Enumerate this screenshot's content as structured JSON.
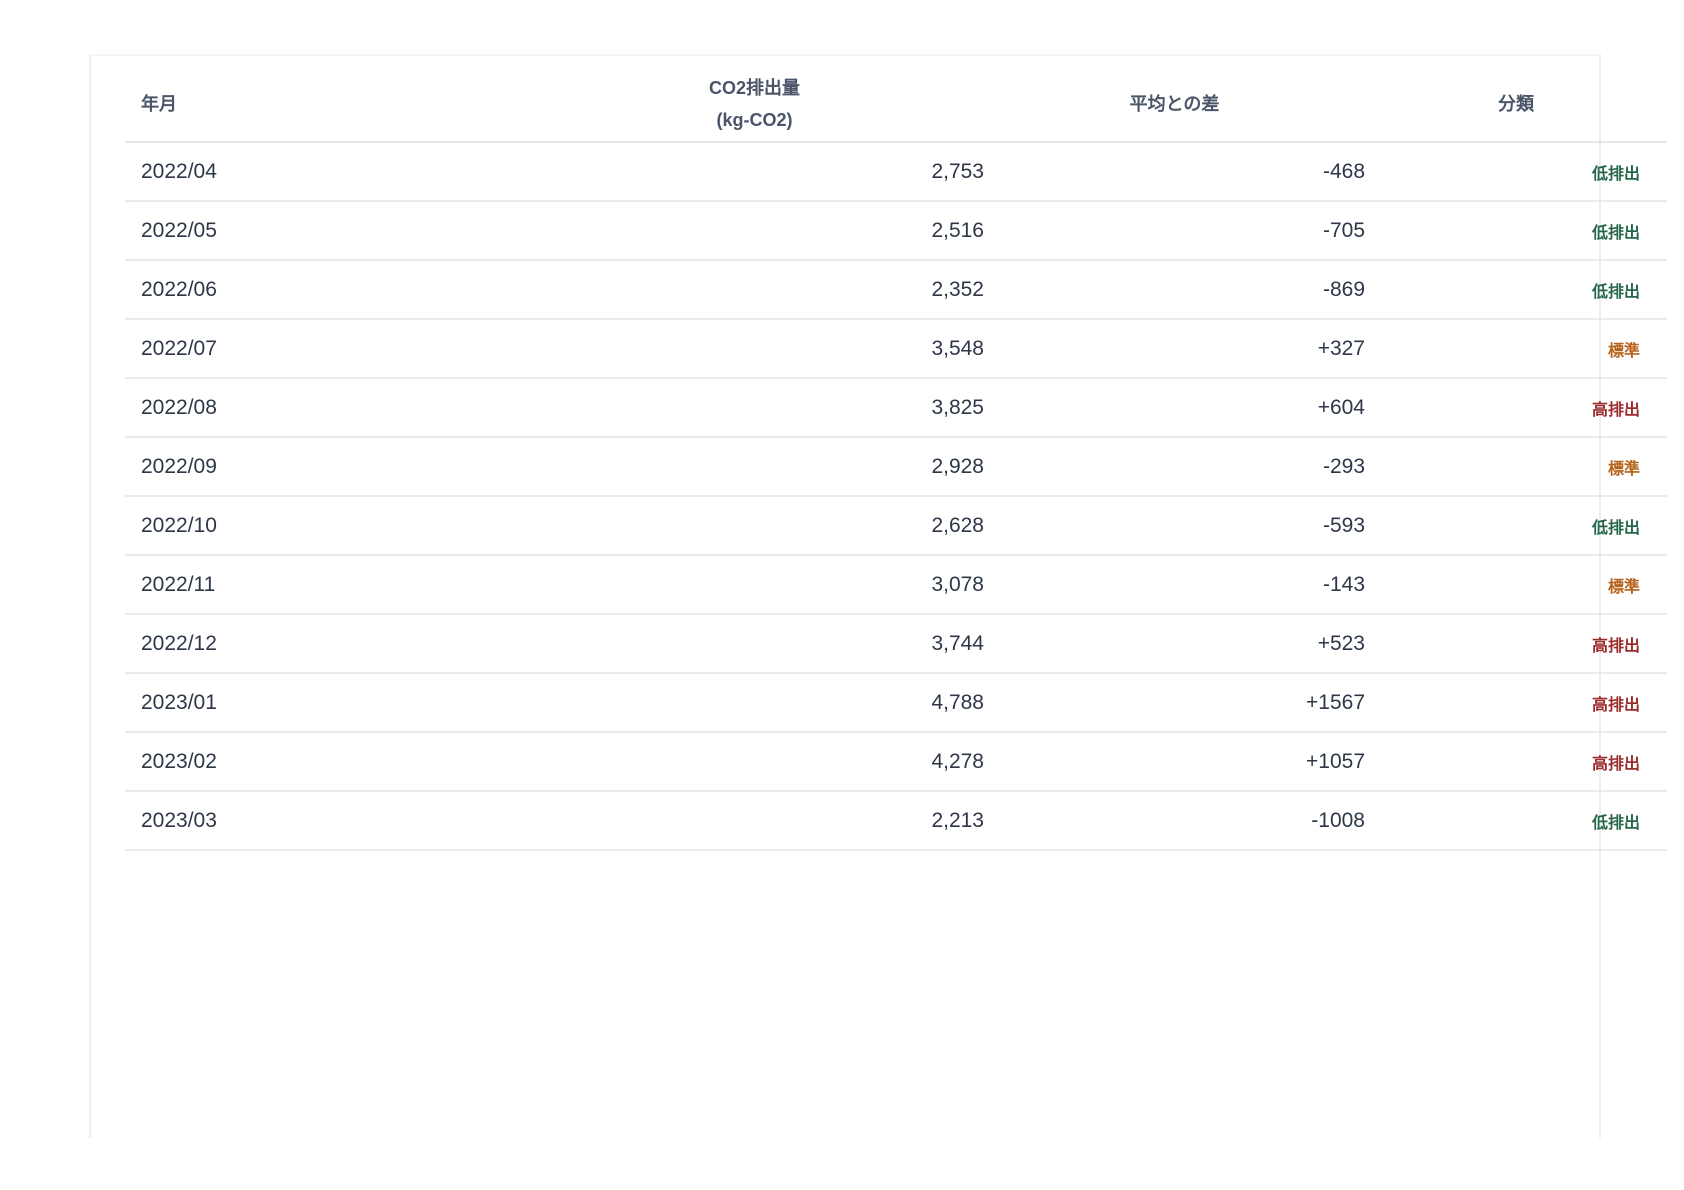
{
  "table": {
    "headers": {
      "month": "年月",
      "co2_line1": "CO2排出量",
      "co2_line2": "(kg-CO2)",
      "diff": "平均との差",
      "category": "分類"
    },
    "rows": [
      {
        "month": "2022/04",
        "co2": "2,753",
        "diff": "-468",
        "category": "低排出",
        "level": "low"
      },
      {
        "month": "2022/05",
        "co2": "2,516",
        "diff": "-705",
        "category": "低排出",
        "level": "low"
      },
      {
        "month": "2022/06",
        "co2": "2,352",
        "diff": "-869",
        "category": "低排出",
        "level": "low"
      },
      {
        "month": "2022/07",
        "co2": "3,548",
        "diff": "+327",
        "category": "標準",
        "level": "std"
      },
      {
        "month": "2022/08",
        "co2": "3,825",
        "diff": "+604",
        "category": "高排出",
        "level": "high"
      },
      {
        "month": "2022/09",
        "co2": "2,928",
        "diff": "-293",
        "category": "標準",
        "level": "std"
      },
      {
        "month": "2022/10",
        "co2": "2,628",
        "diff": "-593",
        "category": "低排出",
        "level": "low"
      },
      {
        "month": "2022/11",
        "co2": "3,078",
        "diff": "-143",
        "category": "標準",
        "level": "std"
      },
      {
        "month": "2022/12",
        "co2": "3,744",
        "diff": "+523",
        "category": "高排出",
        "level": "high"
      },
      {
        "month": "2023/01",
        "co2": "4,788",
        "diff": "+1567",
        "category": "高排出",
        "level": "high"
      },
      {
        "month": "2023/02",
        "co2": "4,278",
        "diff": "+1057",
        "category": "高排出",
        "level": "high"
      },
      {
        "month": "2023/03",
        "co2": "2,213",
        "diff": "-1008",
        "category": "低排出",
        "level": "low"
      }
    ]
  },
  "colors": {
    "low": "#276749",
    "std": "#b7621b",
    "high": "#9b2c2c"
  }
}
